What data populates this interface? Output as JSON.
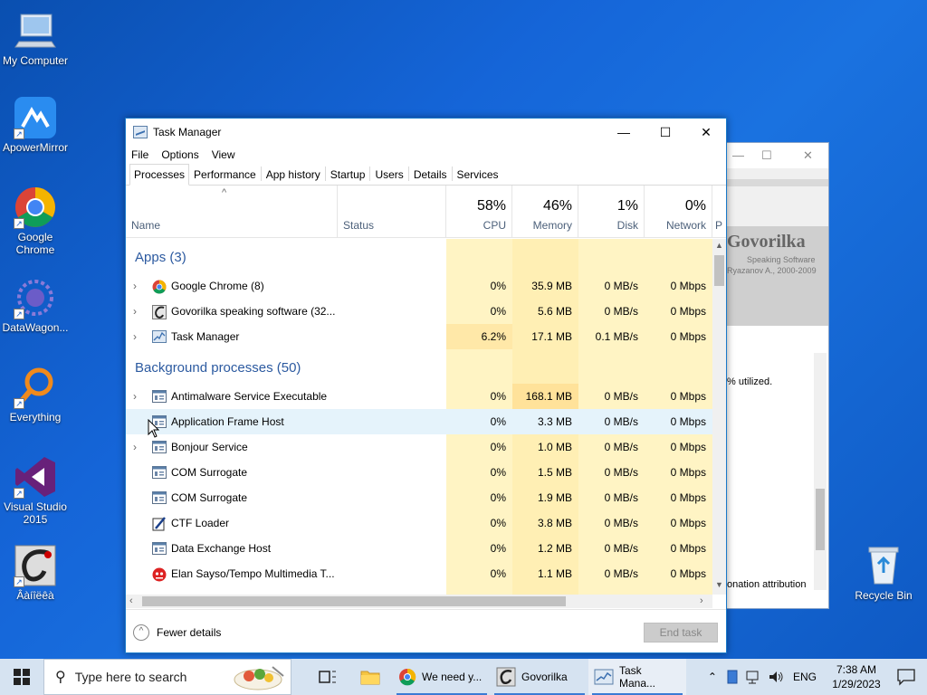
{
  "desktop_icons": [
    {
      "label": "My Computer",
      "icon": "computer-icon"
    },
    {
      "label": "ApowerMirror",
      "icon": "apowermirror-icon"
    },
    {
      "label": "Google Chrome",
      "icon": "chrome-icon"
    },
    {
      "label": "DataWagon...",
      "icon": "datawagon-icon"
    },
    {
      "label": "Everything",
      "icon": "search-magnifier-icon"
    },
    {
      "label": "Visual Studio 2015",
      "icon": "visual-studio-icon"
    },
    {
      "label": "Âàíîëêà",
      "icon": "govorilka-icon"
    }
  ],
  "recycle_bin": {
    "label": "Recycle Bin"
  },
  "background_window": {
    "title_brand": "Govorilka",
    "subtitle": "Speaking Software",
    "credit": "Ryazanov A., 2000-2009",
    "text_utilized": "% utilized.",
    "text_attribution": "onation attribution"
  },
  "task_manager": {
    "title": "Task Manager",
    "menu": [
      "File",
      "Options",
      "View"
    ],
    "tabs": [
      "Processes",
      "Performance",
      "App history",
      "Startup",
      "Users",
      "Details",
      "Services"
    ],
    "active_tab": "Processes",
    "columns": {
      "name": "Name",
      "status": "Status",
      "cpu": {
        "label": "CPU",
        "pct": "58%"
      },
      "memory": {
        "label": "Memory",
        "pct": "46%"
      },
      "disk": {
        "label": "Disk",
        "pct": "1%"
      },
      "network": {
        "label": "Network",
        "pct": "0%"
      },
      "power": "P"
    },
    "groups": {
      "apps": "Apps (3)",
      "background": "Background processes (50)"
    },
    "apps": [
      {
        "name": "Google Chrome (8)",
        "cpu": "0%",
        "memory": "35.9 MB",
        "disk": "0 MB/s",
        "network": "0 Mbps",
        "expandable": true,
        "icon": "chrome-icon"
      },
      {
        "name": "Govorilka speaking software (32...",
        "cpu": "0%",
        "memory": "5.6 MB",
        "disk": "0 MB/s",
        "network": "0 Mbps",
        "expandable": true,
        "icon": "govorilka-icon"
      },
      {
        "name": "Task Manager",
        "cpu": "6.2%",
        "memory": "17.1 MB",
        "disk": "0.1 MB/s",
        "network": "0 Mbps",
        "expandable": true,
        "icon": "task-manager-icon"
      }
    ],
    "background": [
      {
        "name": "Antimalware Service Executable",
        "cpu": "0%",
        "memory": "168.1 MB",
        "disk": "0 MB/s",
        "network": "0 Mbps",
        "expandable": true,
        "icon": "service-icon"
      },
      {
        "name": "Application Frame Host",
        "cpu": "0%",
        "memory": "3.3 MB",
        "disk": "0 MB/s",
        "network": "0 Mbps",
        "expandable": false,
        "icon": "service-icon"
      },
      {
        "name": "Bonjour Service",
        "cpu": "0%",
        "memory": "1.0 MB",
        "disk": "0 MB/s",
        "network": "0 Mbps",
        "expandable": true,
        "icon": "service-icon"
      },
      {
        "name": "COM Surrogate",
        "cpu": "0%",
        "memory": "1.5 MB",
        "disk": "0 MB/s",
        "network": "0 Mbps",
        "expandable": false,
        "icon": "service-icon"
      },
      {
        "name": "COM Surrogate",
        "cpu": "0%",
        "memory": "1.9 MB",
        "disk": "0 MB/s",
        "network": "0 Mbps",
        "expandable": false,
        "icon": "service-icon"
      },
      {
        "name": "CTF Loader",
        "cpu": "0%",
        "memory": "3.8 MB",
        "disk": "0 MB/s",
        "network": "0 Mbps",
        "expandable": false,
        "icon": "ctf-loader-icon"
      },
      {
        "name": "Data Exchange Host",
        "cpu": "0%",
        "memory": "1.2 MB",
        "disk": "0 MB/s",
        "network": "0 Mbps",
        "expandable": false,
        "icon": "service-icon"
      },
      {
        "name": "Elan Sayso/Tempo Multimedia T...",
        "cpu": "0%",
        "memory": "1.1 MB",
        "disk": "0 MB/s",
        "network": "0 Mbps",
        "expandable": false,
        "icon": "elan-icon"
      }
    ],
    "fewer_details": "Fewer details",
    "end_task": "End task"
  },
  "taskbar": {
    "search_placeholder": "Type here to search",
    "items": [
      {
        "label": "We need y...",
        "icon": "chrome-icon"
      },
      {
        "label": "Govorilka",
        "icon": "govorilka-icon"
      },
      {
        "label": "Task Mana...",
        "icon": "task-manager-icon"
      }
    ],
    "lang": "ENG",
    "time": "7:38 AM",
    "date": "1/29/2023"
  },
  "colors": {
    "accent": "#1979ca",
    "group_header": "#2c5aa0",
    "heat_light": "#fff4c4",
    "heat_medium": "#ffe8a8"
  }
}
